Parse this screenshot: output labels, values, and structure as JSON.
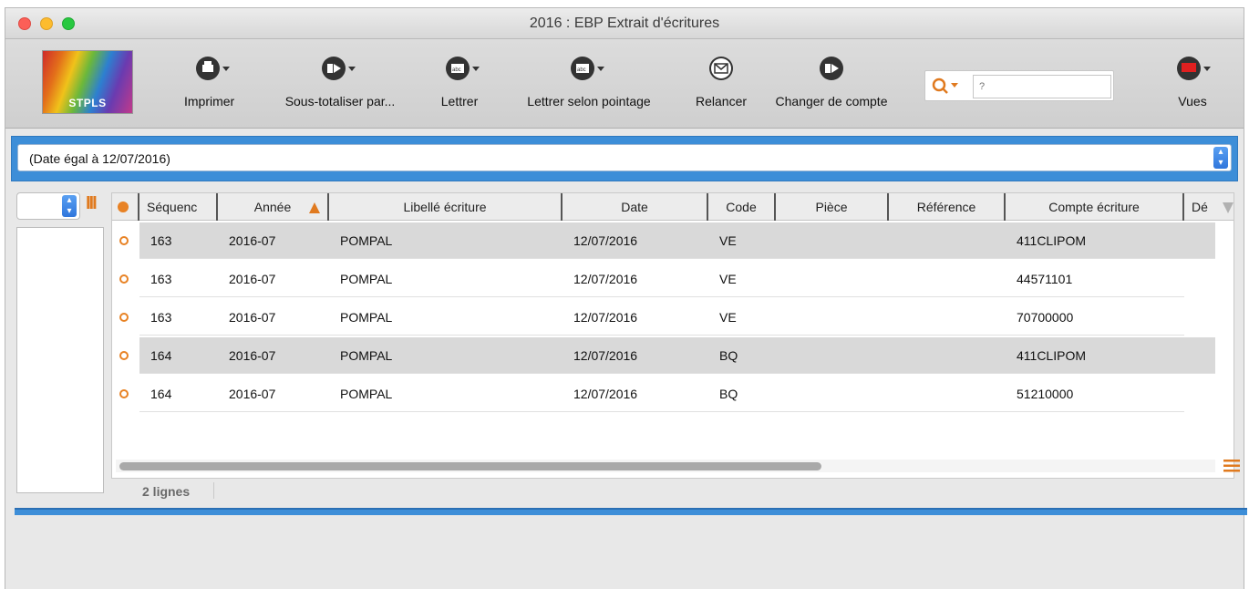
{
  "window": {
    "title": "2016 : EBP Extrait d'écritures"
  },
  "logo": {
    "text": "STPLS"
  },
  "toolbar": {
    "buttons": [
      {
        "label": "Imprimer",
        "icon": "printer-icon"
      },
      {
        "label": "Sous-totaliser par...",
        "icon": "subtotal-icon"
      },
      {
        "label": "Lettrer",
        "icon": "letter-icon"
      },
      {
        "label": "Lettrer selon pointage",
        "icon": "letter-pointing-icon"
      },
      {
        "label": "Relancer",
        "icon": "envelope-icon"
      },
      {
        "label": "Changer de compte",
        "icon": "change-account-icon"
      },
      {
        "label": "Vues",
        "icon": "views-icon"
      }
    ],
    "search": {
      "placeholder": "?"
    }
  },
  "filter": {
    "label": "(Date égal à 12/07/2016)"
  },
  "table": {
    "columns": [
      "Séquenc",
      "Année",
      "Libellé écriture",
      "Date",
      "Code",
      "Pièce",
      "Référence",
      "Compte écriture",
      "Dé"
    ],
    "rows": [
      {
        "sequence": "163",
        "annee": "2016-07",
        "libelle": "POMPAL",
        "date": "12/07/2016",
        "code": "VE",
        "piece": "",
        "reference": "",
        "compte": "411CLIPOM",
        "shaded": true
      },
      {
        "sequence": "163",
        "annee": "2016-07",
        "libelle": "POMPAL",
        "date": "12/07/2016",
        "code": "VE",
        "piece": "",
        "reference": "",
        "compte": "44571101",
        "shaded": false
      },
      {
        "sequence": "163",
        "annee": "2016-07",
        "libelle": "POMPAL",
        "date": "12/07/2016",
        "code": "VE",
        "piece": "",
        "reference": "",
        "compte": "70700000",
        "shaded": false
      },
      {
        "sequence": "164",
        "annee": "2016-07",
        "libelle": "POMPAL",
        "date": "12/07/2016",
        "code": "BQ",
        "piece": "",
        "reference": "",
        "compte": "411CLIPOM",
        "shaded": true
      },
      {
        "sequence": "164",
        "annee": "2016-07",
        "libelle": "POMPAL",
        "date": "12/07/2016",
        "code": "BQ",
        "piece": "",
        "reference": "",
        "compte": "51210000",
        "shaded": false
      }
    ]
  },
  "status": {
    "lines": "2 lignes"
  },
  "colors": {
    "accent_blue": "#3d8ed8",
    "orange": "#e88224"
  }
}
